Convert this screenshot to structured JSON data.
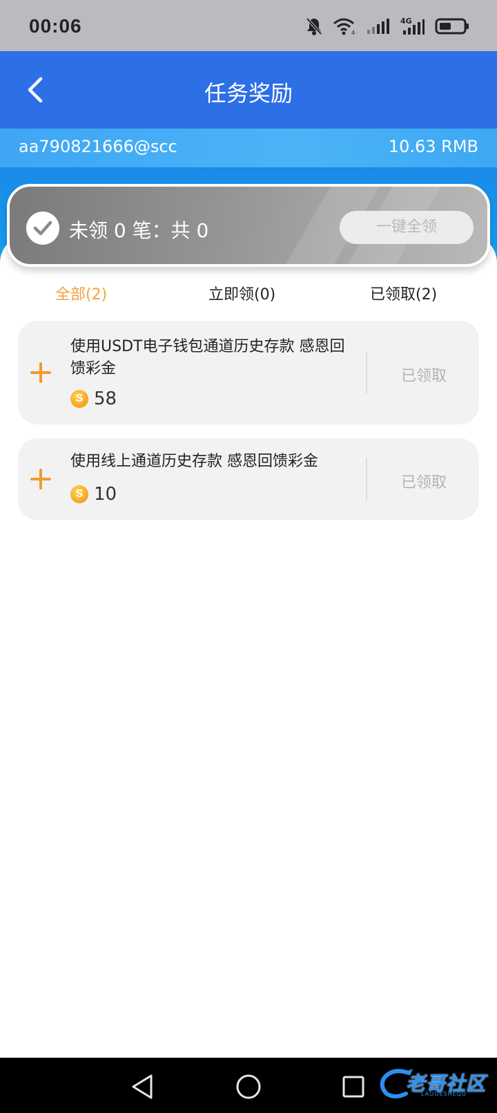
{
  "status_bar": {
    "time": "00:06",
    "icons": [
      "bell-muted-icon",
      "wifi-icon",
      "signal-icon",
      "4g-signal-icon",
      "battery-icon"
    ],
    "network_label": "4G"
  },
  "header": {
    "title": "任务奖励",
    "back_icon": "chevron-left-icon",
    "background": "#2c6fe6"
  },
  "account": {
    "username": "aa790821666@scc",
    "balance": "10.63 RMB"
  },
  "summary": {
    "text": "未领 0 笔：共 0",
    "claim_all_label": "一键全领"
  },
  "tabs": [
    {
      "label": "全部(2)",
      "active": true
    },
    {
      "label": "立即领(0)",
      "active": false
    },
    {
      "label": "已领取(2)",
      "active": false
    }
  ],
  "tasks": [
    {
      "title": "使用USDT电子钱包通道历史存款 感恩回馈彩金",
      "amount": "58",
      "status": "已领取"
    },
    {
      "title": "使用线上通道历史存款 感恩回馈彩金",
      "amount": "10",
      "status": "已领取"
    }
  ],
  "coin_symbol": "S",
  "accent_color": "#f0a43a",
  "watermark": {
    "text": "老哥社区",
    "subtext": "LAOGESHEQU"
  }
}
